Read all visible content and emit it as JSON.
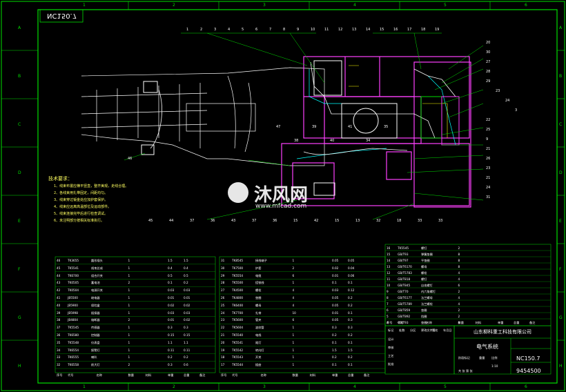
{
  "drawing": {
    "number_mirrored": "NC150.7",
    "company": "山东柳科重工科技有限公司",
    "system_name": "电气系统",
    "model": "NC150.7",
    "code": "9454500"
  },
  "frame": {
    "top_columns": [
      "1",
      "2",
      "3",
      "4",
      "5",
      "6"
    ],
    "side_rows": [
      "A",
      "B",
      "C",
      "D",
      "E",
      "F",
      "G",
      "H"
    ]
  },
  "tech_requirements": {
    "heading": "技术要求：",
    "lines": [
      "1、线束布置应横平竖直，整齐美观，走线合理。",
      "2、各线束用扎带固定，间距均匀。",
      "3、线束穿过钣金处应加护套保护。",
      "4、线束应远离高温部位及运动部件。",
      "5、线束连接完毕后进行检查调试。",
      "6、未注明部分按相关标准执行。"
    ]
  },
  "callouts": {
    "top": [
      "1",
      "2",
      "3",
      "4",
      "5",
      "6",
      "7",
      "8",
      "9",
      "10",
      "11",
      "12",
      "13",
      "14",
      "15",
      "16",
      "17",
      "18",
      "19"
    ],
    "right": [
      "20",
      "30",
      "27",
      "28",
      "29",
      "23",
      "24",
      "3",
      "22",
      "25",
      "9",
      "21",
      "26",
      "23",
      "21",
      "24",
      "31"
    ],
    "bottom": [
      "46",
      "45",
      "44",
      "37",
      "36",
      "43",
      "37",
      "36",
      "15",
      "42",
      "15",
      "13",
      "32",
      "18",
      "33",
      "33"
    ],
    "misc": [
      "47",
      "38",
      "39",
      "40",
      "41",
      "34",
      "35"
    ]
  },
  "watermark": {
    "brand": "沐风网",
    "url": "www.mfcad.com"
  },
  "bom_header": [
    "序号",
    "代号",
    "名称",
    "数量",
    "材料",
    "单重",
    "总重",
    "备注"
  ],
  "bom_left": [
    [
      "46",
      "TK3655",
      "圆形插头",
      "1",
      "",
      "1.5",
      "1.5",
      ""
    ],
    [
      "45",
      "TK5541",
      "线束总成",
      "1",
      "",
      "0.4",
      "0.4",
      ""
    ],
    [
      "44",
      "TK6700",
      "组合开关",
      "1",
      "",
      "0.5",
      "0.5",
      ""
    ],
    [
      "43",
      "TK0505",
      "蓄电池",
      "2",
      "",
      "0.1",
      "0.2",
      ""
    ],
    [
      "42",
      "TK0504",
      "电源开关",
      "1",
      "",
      "0.03",
      "0.03",
      ""
    ],
    [
      "41",
      "JB5500",
      "继电器",
      "1",
      "",
      "0.01",
      "0.01",
      ""
    ],
    [
      "40",
      "JB5900",
      "保险盒",
      "1",
      "",
      "0.02",
      "0.02",
      ""
    ],
    [
      "39",
      "JB5998",
      "插接器",
      "1",
      "",
      "0.03",
      "0.03",
      ""
    ],
    [
      "38",
      "JB4804",
      "熔断器",
      "2",
      "",
      "0.01",
      "0.02",
      ""
    ],
    [
      "37",
      "TK5545",
      "传感器",
      "1",
      "",
      "0.3",
      "0.3",
      ""
    ],
    [
      "36",
      "TK6580",
      "控制器",
      "1",
      "",
      "0.15",
      "0.15",
      ""
    ],
    [
      "35",
      "TK5548",
      "仪表盘",
      "1",
      "",
      "1.1",
      "1.1",
      ""
    ],
    [
      "34",
      "TK6554",
      "报警灯",
      "1",
      "",
      "0.11",
      "0.11",
      ""
    ],
    [
      "33",
      "TK6555",
      "喇叭",
      "1",
      "",
      "0.2",
      "0.2",
      ""
    ],
    [
      "32",
      "TK6558",
      "前大灯",
      "2",
      "",
      "0.3",
      "0.6",
      ""
    ]
  ],
  "bom_mid": [
    [
      "31",
      "TK8545",
      "接线端子",
      "1",
      "",
      "0.05",
      "0.05",
      ""
    ],
    [
      "30",
      "TK7500",
      "护套",
      "2",
      "",
      "0.02",
      "0.04",
      ""
    ],
    [
      "29",
      "TK5554",
      "电缆",
      "6",
      "",
      "0.01",
      "0.06",
      ""
    ],
    [
      "28",
      "TK5500",
      "搭铁线",
      "1",
      "",
      "0.1",
      "0.1",
      ""
    ],
    [
      "27",
      "TK4500",
      "螺栓",
      "4",
      "",
      "0.03",
      "0.12",
      ""
    ],
    [
      "26",
      "TK4800",
      "垫圈",
      "4",
      "",
      "0.05",
      "0.2",
      ""
    ],
    [
      "25",
      "TK6400",
      "螺母",
      "4",
      "",
      "0.05",
      "0.2",
      ""
    ],
    [
      "24",
      "TK7700",
      "扎带",
      "10",
      "",
      "0.01",
      "0.1",
      ""
    ],
    [
      "23",
      "TK5600",
      "管夹",
      "6",
      "",
      "0.05",
      "0.3",
      ""
    ],
    [
      "22",
      "TK5604",
      "波纹管",
      "1",
      "",
      "0.3",
      "0.3",
      ""
    ],
    [
      "21",
      "TK5540",
      "电线",
      "1",
      "",
      "0.2",
      "0.2",
      ""
    ],
    [
      "20",
      "TK5541",
      "尾灯",
      "1",
      "",
      "0.1",
      "0.1",
      ""
    ],
    [
      "19",
      "TK5542",
      "转向灯",
      "1",
      "",
      "1.5",
      "1.5",
      ""
    ],
    [
      "18",
      "TK5543",
      "开关",
      "1",
      "",
      "0.2",
      "0.2",
      ""
    ],
    [
      "17",
      "TK5544",
      "插座",
      "1",
      "",
      "0.1",
      "0.1",
      ""
    ]
  ],
  "bom_right": [
    [
      "16",
      "TK5545",
      "螺钉",
      "2",
      "",
      "",
      "",
      ""
    ],
    [
      "15",
      "GB/T93",
      "弹簧垫圈",
      "8",
      "",
      "",
      "",
      ""
    ],
    [
      "14",
      "GB/T97",
      "平垫圈",
      "8",
      "",
      "",
      "",
      ""
    ],
    [
      "13",
      "GB/T6170",
      "螺母",
      "8",
      "",
      "",
      "",
      ""
    ],
    [
      "12",
      "GB/T5783",
      "螺栓",
      "4",
      "",
      "",
      "",
      ""
    ],
    [
      "11",
      "GB/T818",
      "螺钉",
      "4",
      "",
      "",
      "",
      ""
    ],
    [
      "10",
      "GB/T845",
      "自攻螺钉",
      "6",
      "",
      "",
      "",
      ""
    ],
    [
      "9",
      "GB/T70",
      "内六角螺钉",
      "2",
      "",
      "",
      "",
      ""
    ],
    [
      "8",
      "GB/T6177",
      "法兰螺母",
      "4",
      "",
      "",
      "",
      ""
    ],
    [
      "7",
      "GB/T5789",
      "法兰螺栓",
      "4",
      "",
      "",
      "",
      ""
    ],
    [
      "6",
      "GB/T859",
      "垫圈",
      "2",
      "",
      "",
      "",
      ""
    ],
    [
      "5",
      "GB/T892",
      "挡圈",
      "2",
      "",
      "",
      "",
      ""
    ],
    [
      "4",
      "GB/T93",
      "垫圈",
      "4",
      "",
      "",
      "",
      ""
    ]
  ],
  "title_block": {
    "labels": [
      "标记",
      "处数",
      "分区",
      "更改文件号",
      "签名",
      "年月日"
    ],
    "roles": [
      "设计",
      "审核",
      "工艺",
      "批准"
    ],
    "stage": "阶段标记",
    "weight": "重量",
    "scale": "比例",
    "scale_value": "1:10",
    "sheet": "共 张 第 张"
  }
}
